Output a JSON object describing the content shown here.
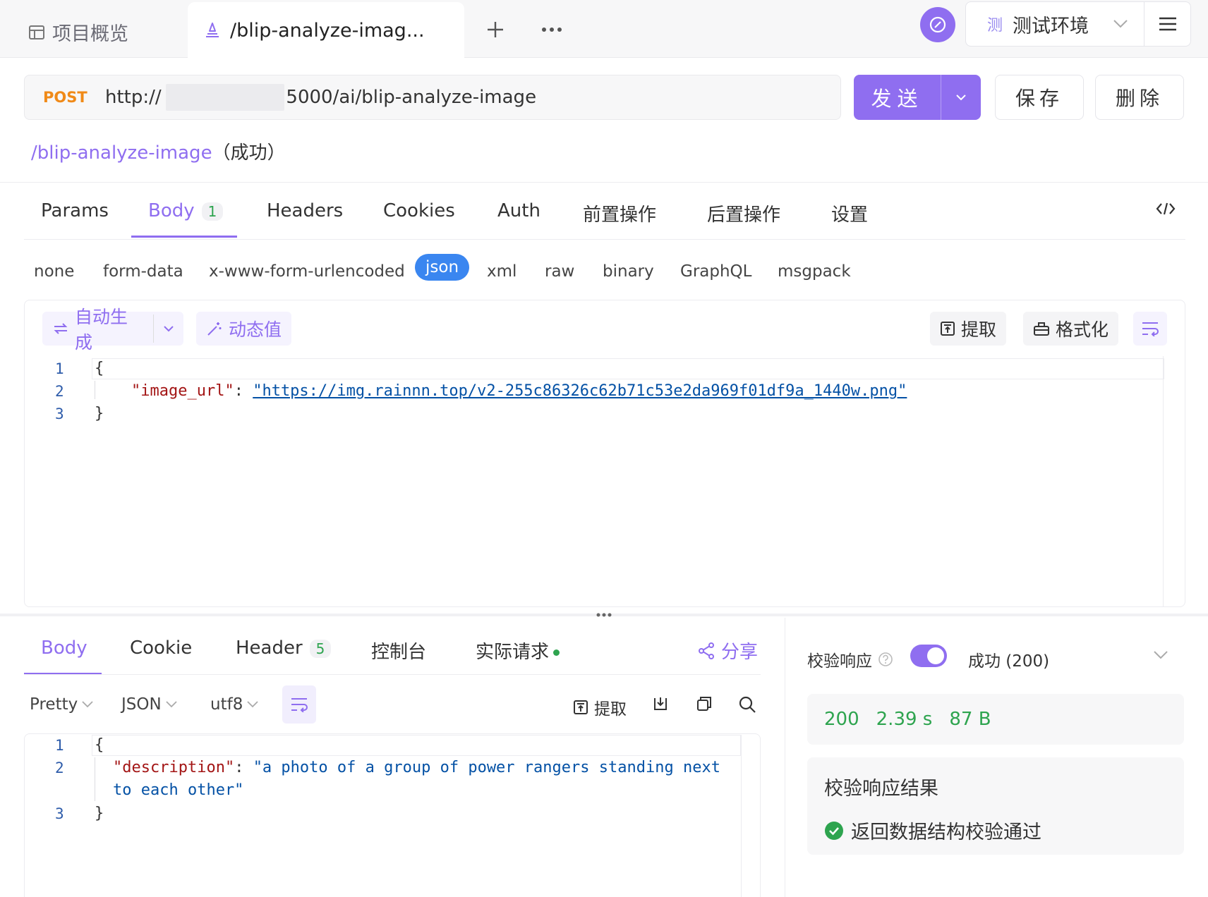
{
  "colors": {
    "accent": "#8f6ef0",
    "method_post": "#f08a18",
    "success": "#2ea44f",
    "json_selected": "#3a86f0"
  },
  "topbar": {
    "overview_label": "项目概览",
    "active_tab_label": "/blip-analyze-imag...",
    "env_badge": "测",
    "env_name": "测试环境"
  },
  "request": {
    "method": "POST",
    "url_prefix": "http://",
    "url_suffix": ":5000/ai/blip-analyze-image",
    "send_label": "发送",
    "save_label": "保存",
    "delete_label": "删除",
    "api_path": "/blip-analyze-image",
    "api_status": "（成功）"
  },
  "req_tabs": {
    "params": "Params",
    "body": "Body",
    "body_count": "1",
    "headers": "Headers",
    "cookies": "Cookies",
    "auth": "Auth",
    "pre": "前置操作",
    "post": "后置操作",
    "settings": "设置"
  },
  "body_types": [
    "none",
    "form-data",
    "x-www-form-urlencoded",
    "json",
    "xml",
    "raw",
    "binary",
    "GraphQL",
    "msgpack"
  ],
  "editor_toolbar": {
    "auto_gen": "自动生成",
    "dynamic": "动态值",
    "extract": "提取",
    "format": "格式化"
  },
  "request_body": {
    "open": "{",
    "key": "\"image_url\"",
    "colon": ": ",
    "value": "\"https://img.rainnn.top/v2-255c86326c62b71c53e2da969f01df9a_1440w.png\"",
    "close": "}",
    "lines": [
      "1",
      "2",
      "3"
    ]
  },
  "response_tabs": {
    "body": "Body",
    "cookie": "Cookie",
    "header": "Header",
    "header_count": "5",
    "console": "控制台",
    "actual": "实际请求",
    "share": "分享"
  },
  "response_toolbar": {
    "pretty": "Pretty",
    "format": "JSON",
    "encoding": "utf8",
    "extract": "提取"
  },
  "response_body": {
    "open": "{",
    "key": "\"description\"",
    "colon": ": ",
    "value_line1": "\"a photo of a group of power rangers standing next",
    "value_line2": "to each other\"",
    "close": "}",
    "lines": [
      "1",
      "2",
      "3"
    ]
  },
  "validation": {
    "label": "校验响应",
    "status": "成功 (200)",
    "code": "200",
    "time": "2.39 s",
    "size": "87 B",
    "result_title": "校验响应结果",
    "result_text": "返回数据结构校验通过"
  }
}
